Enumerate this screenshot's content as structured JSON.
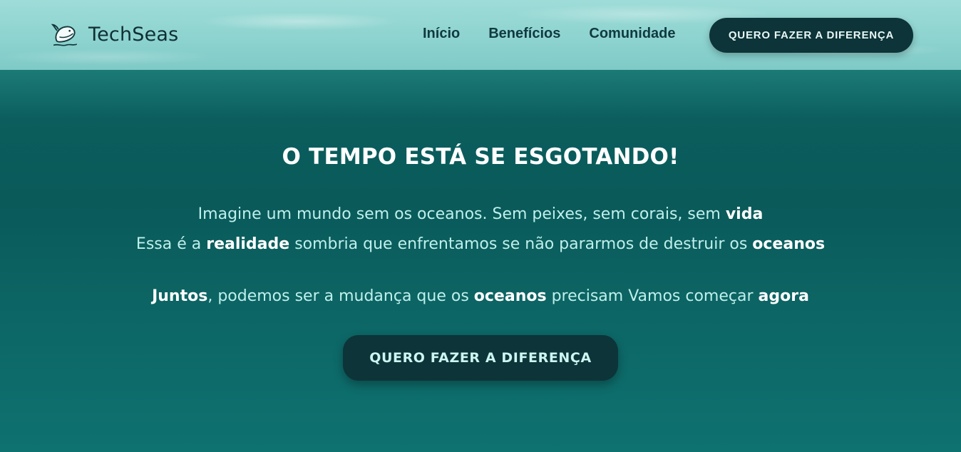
{
  "header": {
    "brand": "TechSeas",
    "logo_icon": "whale-icon",
    "nav": [
      "Início",
      "Benefícios",
      "Comunidade"
    ],
    "cta_label": "QUERO FAZER A DIFERENÇA"
  },
  "hero": {
    "title": "O TEMPO ESTÁ SE ESGOTANDO!",
    "line1": {
      "part1": "Imagine um mundo sem os oceanos. Sem peixes, sem corais, sem ",
      "bold1": "vida"
    },
    "line2": {
      "part1": "Essa é a ",
      "bold1": "realidade",
      "part2": " sombria que enfrentamos se não pararmos de destruir os ",
      "bold2": "oceanos"
    },
    "line3": {
      "bold1": "Juntos",
      "part1": ", podemos ser a mudança que os ",
      "bold2": "oceanos",
      "part2": " precisam Vamos começar ",
      "bold3": "agora"
    },
    "cta_label": "QUERO FAZER A DIFERENÇA"
  },
  "colors": {
    "header_bg": "#8fd4d0",
    "hero_bg": "#0b5e5d",
    "button_bg": "#0d3438",
    "text_light": "#bff0ec",
    "text_white": "#ffffff"
  }
}
